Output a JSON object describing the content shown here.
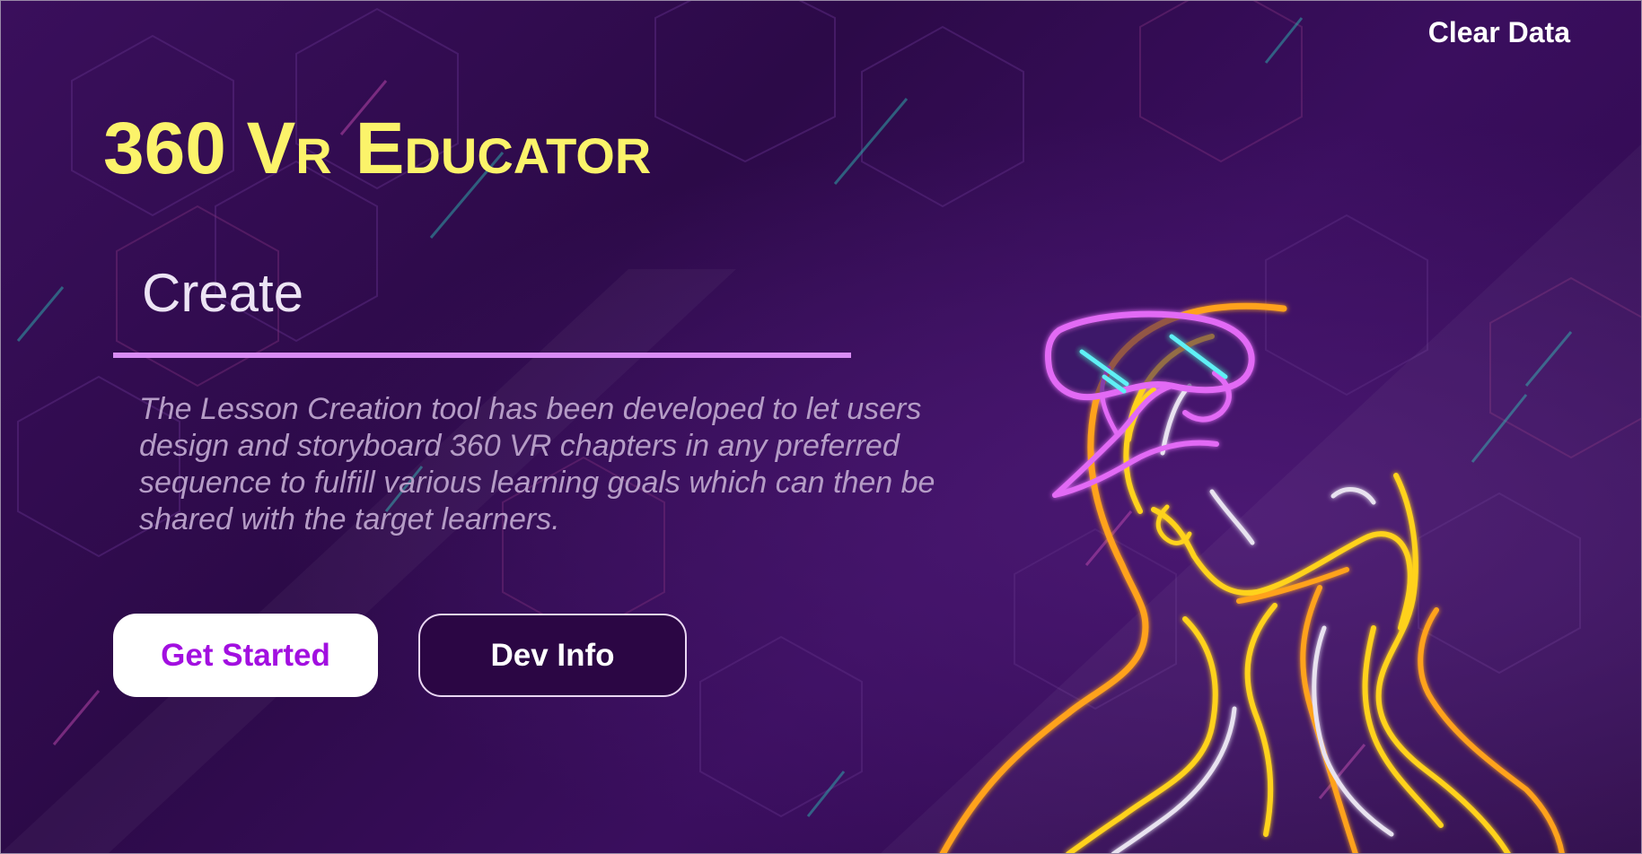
{
  "header": {
    "clear_data_label": "Clear Data"
  },
  "title": {
    "part1": "360 V",
    "part2": "R",
    "part3": "E",
    "part4": "DUCATOR"
  },
  "section": {
    "heading": "Create",
    "description": "The Lesson Creation tool has been developed to let users design and storyboard 360 VR chapters in any preferred sequence to fulfill various learning goals which can then be shared with the target learners."
  },
  "buttons": {
    "get_started_label": "Get Started",
    "dev_info_label": "Dev Info"
  },
  "colors": {
    "background": "#300b50",
    "title": "#fbf36a",
    "accent_rule": "#d98cf5",
    "primary_button_text": "#a20fe0",
    "neon_yellow": "#ffd21a",
    "neon_orange": "#ffa21a",
    "neon_pink": "#e26af5",
    "neon_cyan": "#5ff0f5"
  },
  "icons": {
    "illustration": "vr-headset-person-neon-illustration"
  }
}
